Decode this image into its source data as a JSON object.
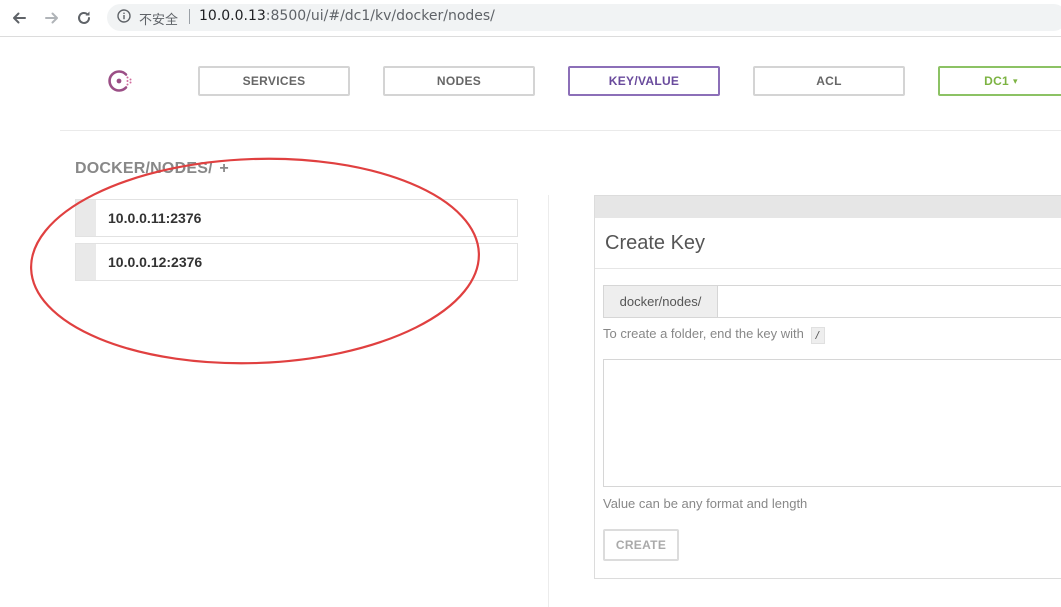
{
  "browser": {
    "insecure_label": "不安全",
    "url_host": "10.0.0.13",
    "url_rest": ":8500/ui/#/dc1/kv/docker/nodes/"
  },
  "nav": {
    "tabs": [
      {
        "label": "SERVICES"
      },
      {
        "label": "NODES"
      },
      {
        "label": "KEY/VALUE",
        "active": true
      },
      {
        "label": "ACL"
      }
    ],
    "datacenter": {
      "label": "DC1",
      "caret": "▾"
    }
  },
  "kv": {
    "path_title": "DOCKER/NODES/",
    "add_symbol": "+",
    "keys": [
      {
        "label": "10.0.0.11:2376"
      },
      {
        "label": "10.0.0.12:2376"
      }
    ]
  },
  "create_key": {
    "title": "Create Key",
    "key_prefix": "docker/nodes/",
    "key_value": "",
    "folder_help": "To create a folder, end the key with",
    "folder_help_code": "/",
    "value_text": "",
    "value_help": "Value can be any format and length",
    "create_label": "CREATE"
  },
  "colors": {
    "active_tab": "#8c6fb8",
    "datacenter_tab": "#8cc264",
    "annotation": "#e04040",
    "logo": "#9b4f86"
  }
}
